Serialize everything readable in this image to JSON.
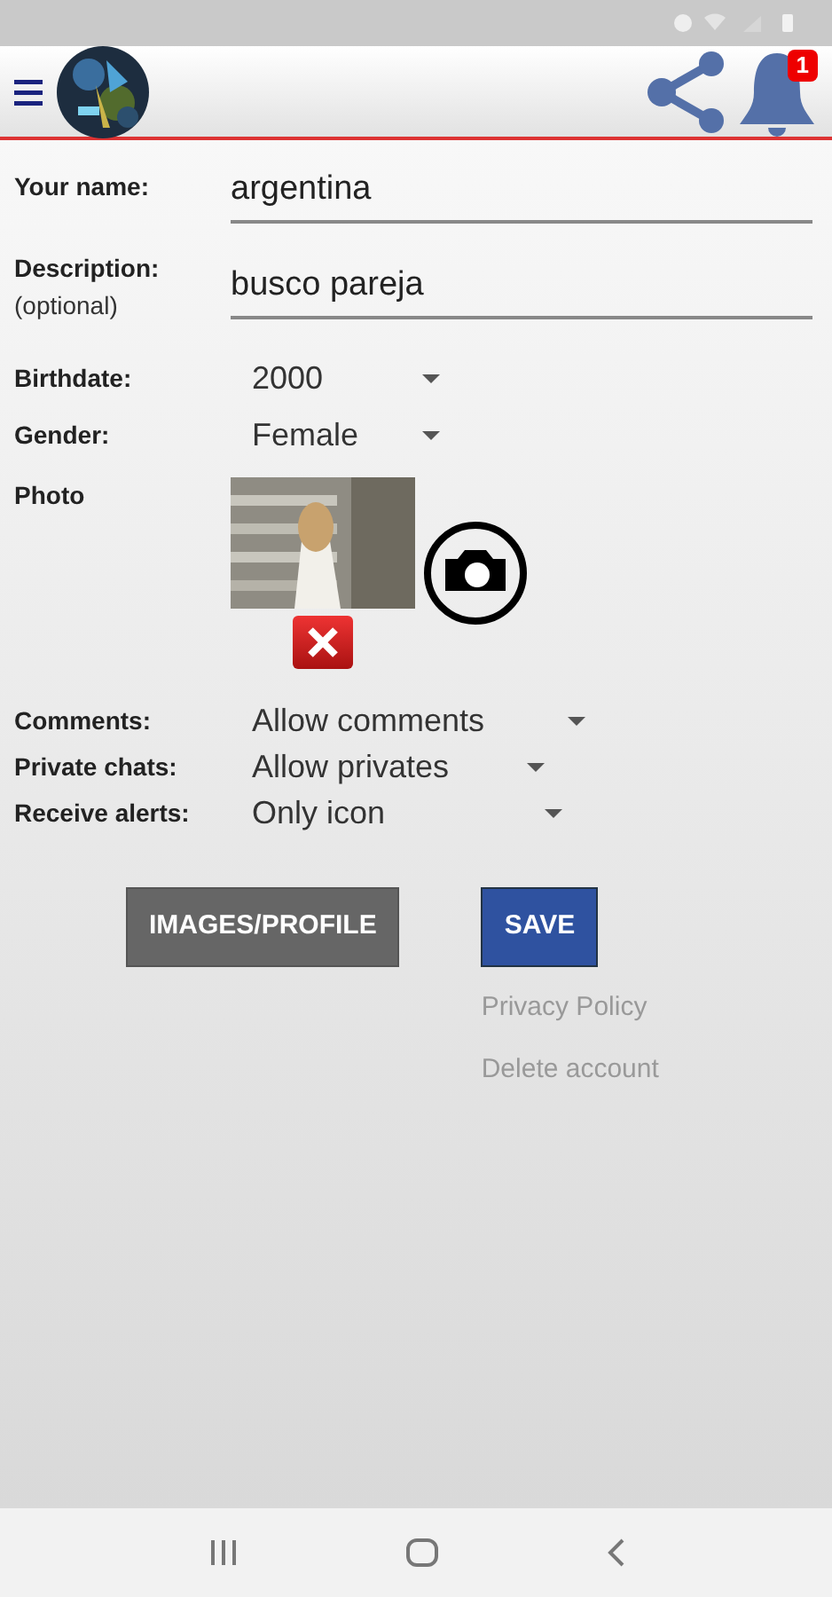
{
  "header": {
    "notification_badge": "1"
  },
  "text_fields": [
    {
      "label": "Your name:",
      "value": "argentina"
    },
    {
      "label": "Description:",
      "sublabel": "(optional)",
      "value": "busco pareja"
    }
  ],
  "dropdowns_top": [
    {
      "label": "Birthdate:",
      "value": "2000"
    },
    {
      "label": "Gender:",
      "value": "Female"
    }
  ],
  "photo": {
    "label": "Photo"
  },
  "dropdowns_bottom": [
    {
      "label": "Comments:",
      "value": "Allow comments"
    },
    {
      "label": "Private chats:",
      "value": "Allow privates"
    },
    {
      "label": "Receive alerts:",
      "value": "Only icon"
    }
  ],
  "buttons": [
    "IMAGES/PROFILE",
    "SAVE"
  ],
  "links": [
    "Privacy Policy",
    "Delete account"
  ]
}
